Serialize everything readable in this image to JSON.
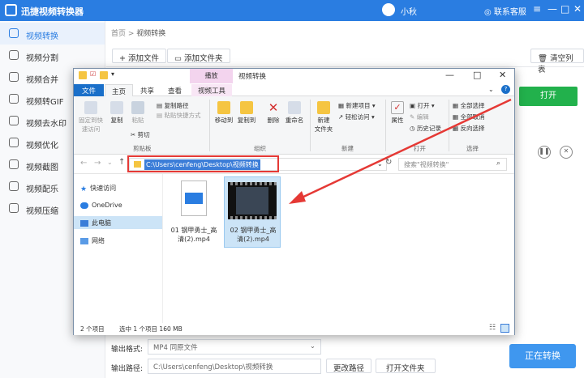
{
  "app": {
    "title": "迅捷视频转换器",
    "user": "小秋",
    "customer_service": "联系客服",
    "window_controls": [
      "≡",
      "—",
      "□",
      "✕"
    ]
  },
  "sidebar": {
    "items": [
      {
        "label": "视频转换",
        "icon": "video-convert-icon",
        "active": true
      },
      {
        "label": "视频分割",
        "icon": "split-icon"
      },
      {
        "label": "视频合并",
        "icon": "merge-icon"
      },
      {
        "label": "视频转GIF",
        "icon": "gif-icon"
      },
      {
        "label": "视频去水印",
        "icon": "watermark-icon"
      },
      {
        "label": "视频优化",
        "icon": "optimize-icon"
      },
      {
        "label": "视频截图",
        "icon": "screenshot-icon"
      },
      {
        "label": "视频配乐",
        "icon": "music-icon"
      },
      {
        "label": "视频压缩",
        "icon": "compress-icon"
      }
    ]
  },
  "breadcrumb": {
    "home": "首页",
    "sep": " > ",
    "current": "视频转换"
  },
  "toolbar": {
    "add_file": "+ 添加文件",
    "add_folder": "添加文件夹",
    "clear_list": "清空列表"
  },
  "task": {
    "open_label": "打开"
  },
  "bottom": {
    "format_label": "输出格式:",
    "format_value": "MP4   同原文件",
    "path_label": "输出路径:",
    "path_value": "C:\\Users\\cenfeng\\Desktop\\视频转换",
    "change_path": "更改路径",
    "open_folder": "打开文件夹",
    "convert": "正在转换"
  },
  "explorer": {
    "title_tab_play": "播放",
    "title": "视频转换",
    "tabs": [
      "文件",
      "主页",
      "共享",
      "查看",
      "视频工具"
    ],
    "ribbon": {
      "pin": "固定到快\n速访问",
      "copy": "复制",
      "paste": "粘贴",
      "copy_path": "复制路径",
      "paste_shortcut": "粘贴快捷方式",
      "cut": "剪切",
      "clipboard": "剪贴板",
      "move_to": "移动到",
      "copy_to": "复制到",
      "delete": "删除",
      "rename": "重命名",
      "organize": "组织",
      "new_folder": "新建\n文件夹",
      "new_item": "新建项目 ▾",
      "easy_access": "轻松访问 ▾",
      "new_group": "新建",
      "properties": "属性",
      "open": "打开 ▾",
      "edit": "编辑",
      "history": "历史记录",
      "open_group": "打开",
      "select_all": "全部选择",
      "select_none": "全部取消",
      "invert": "反向选择",
      "select_group": "选择"
    },
    "address": "C:\\Users\\cenfeng\\Desktop\\视频转换",
    "search_placeholder": "搜索\"视频转换\"",
    "nav": [
      "快速访问",
      "OneDrive",
      "此电脑",
      "网络"
    ],
    "files": [
      {
        "name": "01 钢甲勇士_高\n清(2).mp4"
      },
      {
        "name": "02 钢甲勇士_高\n清(2).mp4",
        "selected": true
      }
    ],
    "status": {
      "count": "2 个项目",
      "selected": "选中 1 个项目  160 MB"
    }
  },
  "colors": {
    "accent": "#2a7de1",
    "open_green": "#22b14c",
    "convert_blue": "#3f97ef",
    "annotation_red": "#e53935"
  }
}
